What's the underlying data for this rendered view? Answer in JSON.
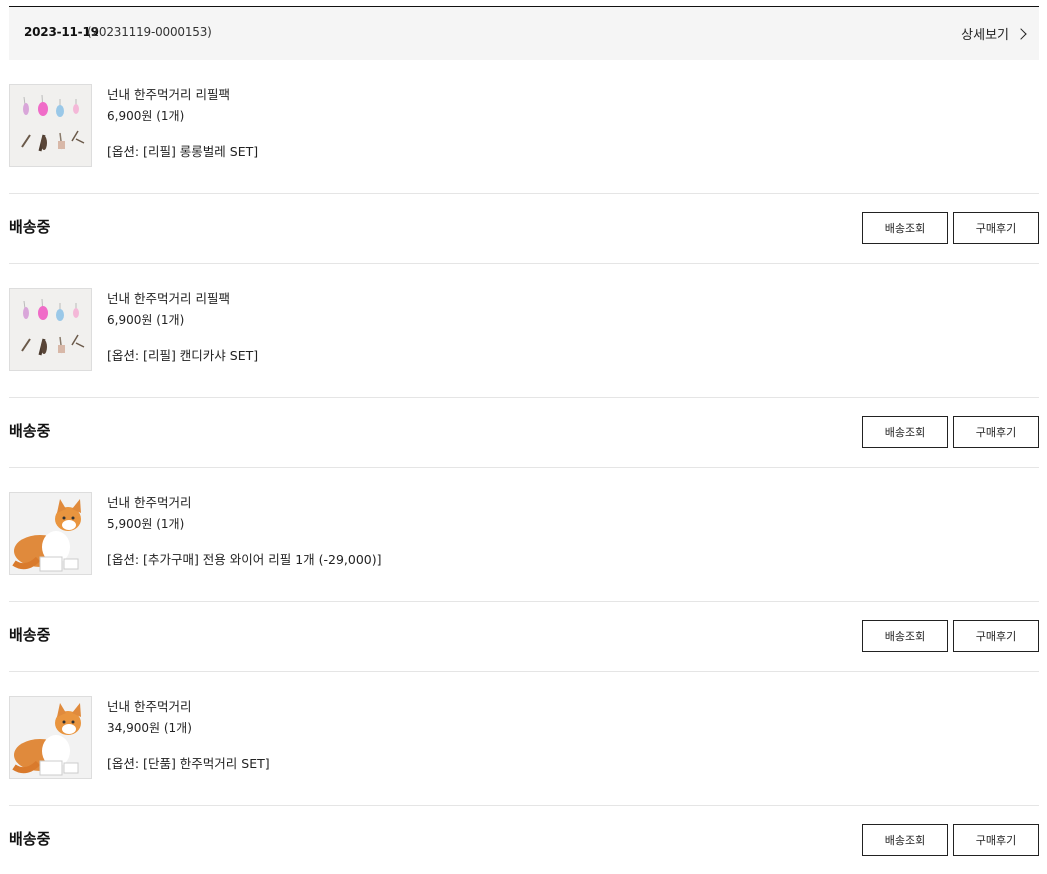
{
  "order": {
    "date": "2023-11-19",
    "number": "(20231119-0000153)",
    "detail_label": "상세보기"
  },
  "items": [
    {
      "name": "넌내 한주먹거리 리필팩",
      "price": "6,900원 (1개)",
      "option": "[옵션: [리필] 롱롱벌레 SET]",
      "thumb": "feather-refill",
      "status": "배송중",
      "track_label": "배송조회",
      "review_label": "구매후기"
    },
    {
      "name": "넌내 한주먹거리 리필팩",
      "price": "6,900원 (1개)",
      "option": "[옵션: [리필] 캔디카샤 SET]",
      "thumb": "feather-refill",
      "status": "배송중",
      "track_label": "배송조회",
      "review_label": "구매후기"
    },
    {
      "name": "넌내 한주먹거리",
      "price": "5,900원 (1개)",
      "option": "[옵션: [추가구매] 전용 와이어 리필 1개 (-29,000)]",
      "thumb": "cat-photo",
      "status": "배송중",
      "track_label": "배송조회",
      "review_label": "구매후기"
    },
    {
      "name": "넌내 한주먹거리",
      "price": "34,900원 (1개)",
      "option": "[옵션: [단품] 한주먹거리 SET]",
      "thumb": "cat-photo",
      "status": "배송중",
      "track_label": "배송조회",
      "review_label": "구매후기"
    }
  ]
}
